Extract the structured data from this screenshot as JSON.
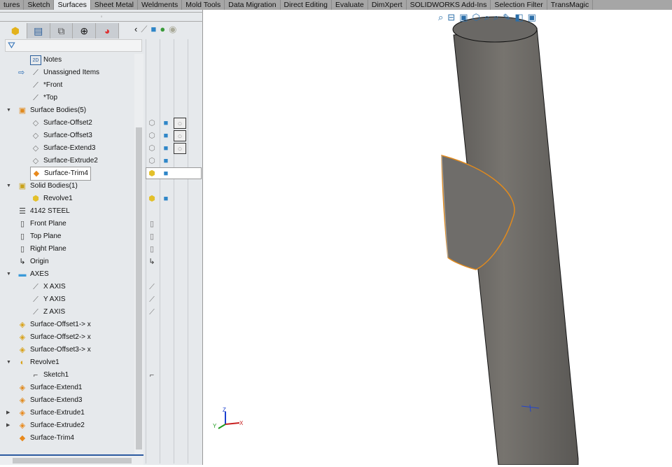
{
  "tabs": [
    {
      "label": "tures"
    },
    {
      "label": "Sketch"
    },
    {
      "label": "Surfaces",
      "active": true
    },
    {
      "label": "Sheet Metal"
    },
    {
      "label": "Weldments"
    },
    {
      "label": "Mold Tools"
    },
    {
      "label": "Data Migration"
    },
    {
      "label": "Direct Editing"
    },
    {
      "label": "Evaluate"
    },
    {
      "label": "DimXpert"
    },
    {
      "label": "SOLIDWORKS Add-Ins"
    },
    {
      "label": "Selection Filter"
    },
    {
      "label": "TransMagic"
    }
  ],
  "manager_tabs": [
    "feature-manager",
    "property-manager",
    "configuration-manager",
    "dimxpert-manager",
    "display-manager"
  ],
  "panel_tools": [
    "collapse-arrow",
    "hide-show",
    "appearance-cube",
    "appearance-edit",
    "visibility"
  ],
  "tree": [
    {
      "label": "Notes",
      "level": 2,
      "icon": "notes-icon"
    },
    {
      "label": "Unassigned Items",
      "level": 2,
      "icon": "annotation-view-icon",
      "arrow": true
    },
    {
      "label": "*Front",
      "level": 2,
      "icon": "annotation-view-icon"
    },
    {
      "label": "*Top",
      "level": 2,
      "icon": "annotation-view-icon"
    },
    {
      "label": "Surface Bodies(5)",
      "level": 1,
      "icon": "surface-bodies-folder-icon",
      "expander": "down"
    },
    {
      "label": "Surface-Offset2",
      "level": 2,
      "icon": "surface-body-icon",
      "cols": [
        "box",
        "cube",
        "sphere"
      ]
    },
    {
      "label": "Surface-Offset3",
      "level": 2,
      "icon": "surface-body-icon",
      "cols": [
        "box",
        "cube",
        "sphere"
      ]
    },
    {
      "label": "Surface-Extend3",
      "level": 2,
      "icon": "surface-body-icon",
      "cols": [
        "box",
        "cube",
        "sphere"
      ]
    },
    {
      "label": "Surface-Extrude2",
      "level": 2,
      "icon": "surface-body-icon",
      "cols": [
        "box",
        "cube"
      ]
    },
    {
      "label": "Surface-Trim4",
      "level": 2,
      "icon": "surface-trim-icon",
      "selected": true,
      "cols": [
        "ybox",
        "cube"
      ]
    },
    {
      "label": "Solid Bodies(1)",
      "level": 1,
      "icon": "solid-bodies-folder-icon",
      "expander": "down"
    },
    {
      "label": "Revolve1",
      "level": 2,
      "icon": "solid-body-icon",
      "cols": [
        "ybox",
        "cube"
      ]
    },
    {
      "label": "4142 STEEL",
      "level": 1,
      "icon": "material-icon"
    },
    {
      "label": "Front Plane",
      "level": 1,
      "icon": "plane-icon",
      "cols": [
        "plane"
      ]
    },
    {
      "label": "Top Plane",
      "level": 1,
      "icon": "plane-icon",
      "cols": [
        "plane"
      ]
    },
    {
      "label": "Right Plane",
      "level": 1,
      "icon": "plane-icon",
      "cols": [
        "plane"
      ]
    },
    {
      "label": "Origin",
      "level": 1,
      "icon": "origin-icon",
      "cols": [
        "origin"
      ]
    },
    {
      "label": "AXES",
      "level": 1,
      "icon": "folder-icon",
      "expander": "down"
    },
    {
      "label": "X AXIS",
      "level": 2,
      "icon": "axis-icon",
      "cols": [
        "axis"
      ]
    },
    {
      "label": "Y AXIS",
      "level": 2,
      "icon": "axis-icon",
      "cols": [
        "axis"
      ]
    },
    {
      "label": "Z AXIS",
      "level": 2,
      "icon": "axis-icon",
      "cols": [
        "axis"
      ]
    },
    {
      "label": "Surface-Offset1-> x",
      "level": 1,
      "icon": "surface-offset-icon"
    },
    {
      "label": "Surface-Offset2-> x",
      "level": 1,
      "icon": "surface-offset-icon"
    },
    {
      "label": "Surface-Offset3-> x",
      "level": 1,
      "icon": "surface-offset-icon"
    },
    {
      "label": "Revolve1",
      "level": 1,
      "icon": "revolve-icon",
      "expander": "down"
    },
    {
      "label": "Sketch1",
      "level": 2,
      "icon": "sketch-icon",
      "cols": [
        "sketch"
      ]
    },
    {
      "label": "Surface-Extend1",
      "level": 1,
      "icon": "surface-extend-icon"
    },
    {
      "label": "Surface-Extend3",
      "level": 1,
      "icon": "surface-extend-icon"
    },
    {
      "label": "Surface-Extrude1",
      "level": 1,
      "icon": "surface-extrude-icon",
      "expander": "right"
    },
    {
      "label": "Surface-Extrude2",
      "level": 1,
      "icon": "surface-extrude-icon",
      "expander": "right"
    },
    {
      "label": "Surface-Trim4",
      "level": 1,
      "icon": "surface-trim-icon"
    }
  ],
  "view_tools": [
    "zoom-to-fit",
    "zoom-area",
    "previous-view",
    "section-view",
    "dynamic-annotation",
    "view-orientation",
    "display-style",
    "hide-show-items",
    "edit-appearance"
  ],
  "triad": {
    "x": "X",
    "y": "Y",
    "z": "Z"
  },
  "colors": {
    "selection": "#e08a1e",
    "body": "#6b6966",
    "accent": "#2c5aa0"
  }
}
